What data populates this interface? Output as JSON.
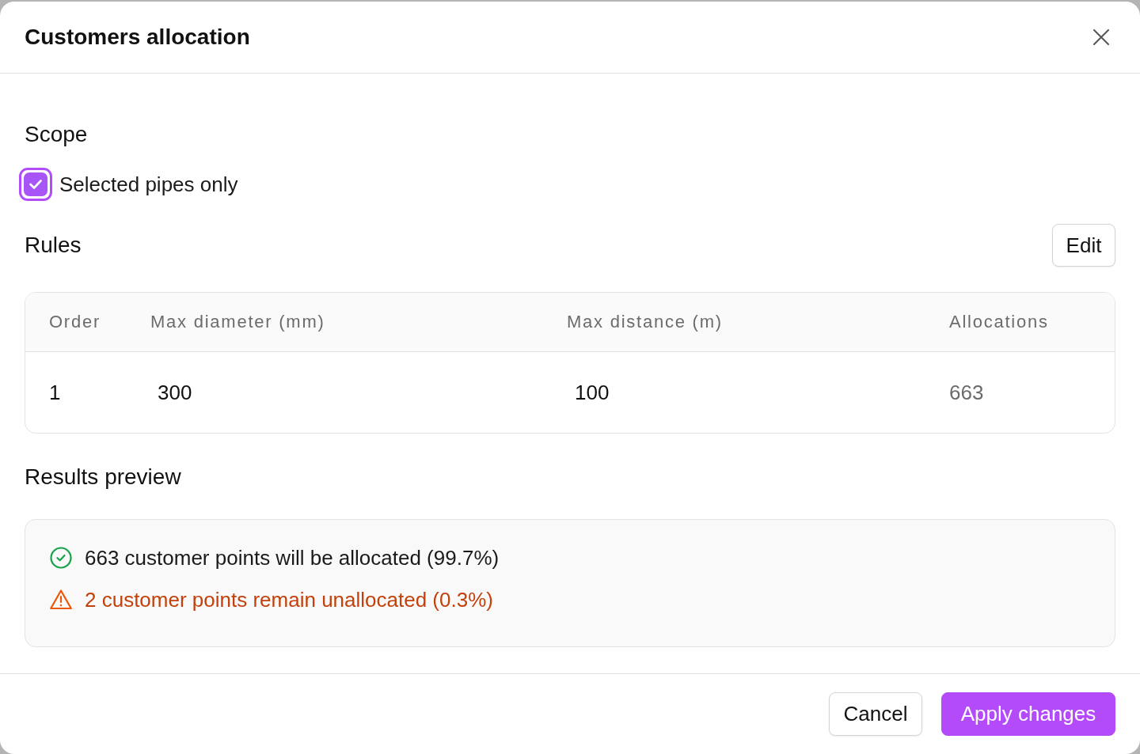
{
  "dialog": {
    "title": "Customers allocation"
  },
  "scope": {
    "heading": "Scope",
    "options": [
      {
        "label": "Selected pipes only",
        "checked": true,
        "focused": true
      }
    ]
  },
  "rules": {
    "heading": "Rules",
    "edit_button": "Edit",
    "table": {
      "columns": [
        "Order",
        "Max diameter (mm)",
        "Max distance (m)",
        "Allocations"
      ],
      "rows": [
        [
          "1",
          "300",
          "100",
          "663"
        ]
      ]
    }
  },
  "results_preview": {
    "heading": "Results preview",
    "messages": [
      {
        "kind": "success",
        "text": "663 customer points will be allocated (99.7%)"
      },
      {
        "kind": "warning",
        "text": "2 customer points remain unallocated (0.3%)"
      }
    ]
  },
  "footer": {
    "buttons": [
      {
        "label": "Cancel",
        "kind": "secondary"
      },
      {
        "label": "Apply changes",
        "kind": "primary"
      }
    ]
  }
}
